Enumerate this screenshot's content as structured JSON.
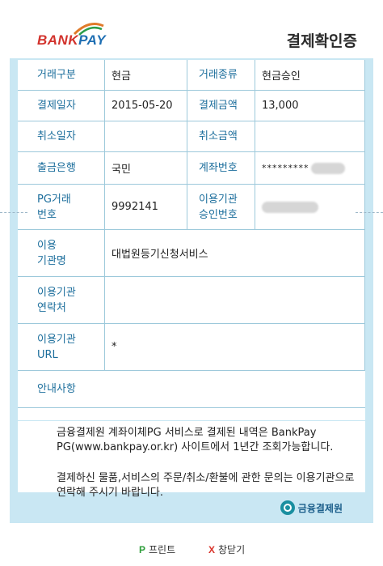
{
  "header": {
    "logo_bank": "BANK",
    "logo_pay": "PAY",
    "title": "결제확인증"
  },
  "rows": {
    "trade_type_label": "거래구분",
    "trade_type_value": "현금",
    "trade_kind_label": "거래종류",
    "trade_kind_value": "현금승인",
    "pay_date_label": "결제일자",
    "pay_date_value": "2015-05-20",
    "pay_amount_label": "결제금액",
    "pay_amount_value": "13,000",
    "cancel_date_label": "취소일자",
    "cancel_amount_label": "취소금액",
    "bank_label": "출금은행",
    "bank_value": "국민",
    "account_label": "계좌번호",
    "account_value": "*********",
    "pg_no_label_1": "PG거래",
    "pg_no_label_2": "번호",
    "pg_no_value": "9992141",
    "approval_label_1": "이용기관",
    "approval_label_2": "승인번호",
    "org_name_label_1": "이용",
    "org_name_label_2": "기관명",
    "org_name_value": "대법원등기신청서비스",
    "org_contact_label_1": "이용기관",
    "org_contact_label_2": "연락처",
    "org_url_label_1": "이용기관",
    "org_url_label_2": "URL",
    "org_url_value": "*",
    "notice_label": "안내사항"
  },
  "notice": {
    "line1": "금융결제원 계좌이체PG 서비스로 결제된 내역은 BankPay PG(www.bankpay.or.kr) 사이트에서 1년간 조회가능합니다.",
    "line2": "결제하신 물품,서비스의 주문/취소/환불에 관한 문의는 이용기관으로 연락해 주시기 바랍니다."
  },
  "footer": {
    "brand": "금융결제원"
  },
  "actions": {
    "print_key": "P",
    "print_label": "프린트",
    "close_key": "X",
    "close_label": "창닫기"
  }
}
